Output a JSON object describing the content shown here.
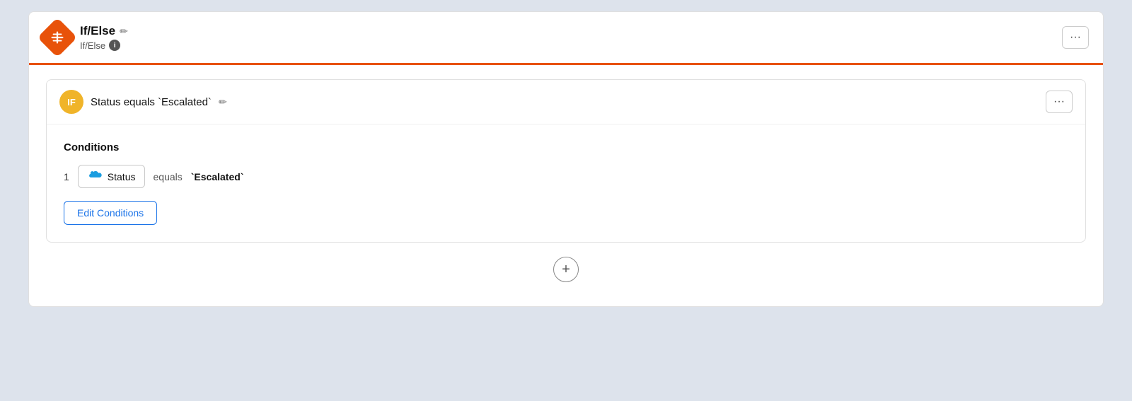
{
  "header": {
    "title": "If/Else",
    "subtitle": "If/Else",
    "more_label": "···",
    "info_label": "i",
    "edit_icon": "✏"
  },
  "if_block": {
    "badge_label": "IF",
    "condition_title": "Status equals `Escalated`",
    "more_label": "···",
    "edit_icon": "✏"
  },
  "conditions": {
    "title": "Conditions",
    "item_num": "1",
    "field_label": "Status",
    "operator": "equals",
    "value": "`Escalated`",
    "edit_button_label": "Edit Conditions"
  },
  "add_button_label": "+"
}
